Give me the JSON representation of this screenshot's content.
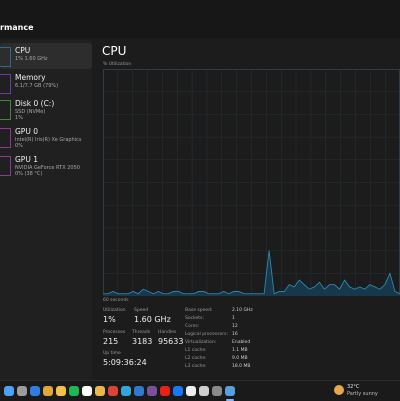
{
  "header": {
    "title": "rmance"
  },
  "sidebar": {
    "items": [
      {
        "name": "CPU",
        "sub": "1%  1.60 GHz",
        "sub2": "",
        "thumb_color": "#2a6a8f"
      },
      {
        "name": "Memory",
        "sub": "6.1/7.7 GB (79%)",
        "sub2": "",
        "thumb_color": "#6b3aa8"
      },
      {
        "name": "Disk 0 (C:)",
        "sub": "SSD (NVMe)",
        "sub2": "1%",
        "thumb_color": "#3c8a3c"
      },
      {
        "name": "GPU 0",
        "sub": "Intel(R) Iris(R) Xe Graphics",
        "sub2": "0%",
        "thumb_color": "#8a3c8a"
      },
      {
        "name": "GPU 1",
        "sub": "NVIDIA GeForce RTX 2050",
        "sub2": "0% (38 °C)",
        "thumb_color": "#8a3c8a"
      }
    ]
  },
  "main": {
    "title": "CPU",
    "axis_label": "% Utilization",
    "time_label": "60 seconds",
    "graph": {
      "line_color": "#2f8fbf",
      "fill_color": "#17384a",
      "grid_color": "#2a3a44",
      "values": [
        1,
        1,
        2,
        1,
        1,
        1,
        2,
        1,
        3,
        2,
        1,
        2,
        1,
        1,
        2,
        2,
        1,
        1,
        1,
        2,
        2,
        1,
        1,
        1,
        2,
        1,
        2,
        2,
        1,
        1,
        1,
        1,
        1,
        20,
        1,
        2,
        2,
        5,
        4,
        7,
        5,
        3,
        4,
        6,
        3,
        5,
        5,
        3,
        7,
        4,
        3,
        4,
        3,
        5,
        4,
        3,
        5,
        10,
        2,
        1
      ]
    },
    "stats": {
      "utilization": {
        "label": "Utilization",
        "value": "1%"
      },
      "speed": {
        "label": "Speed",
        "value": "1.60 GHz"
      },
      "processes": {
        "label": "Processes",
        "value": "215"
      },
      "threads": {
        "label": "Threads",
        "value": "3183"
      },
      "handles": {
        "label": "Handles",
        "value": "95633"
      },
      "uptime": {
        "label": "Up time",
        "value": "5:09:36:24"
      }
    },
    "details": [
      {
        "key": "Base speed:",
        "value": "2.10 GHz"
      },
      {
        "key": "Sockets:",
        "value": "1"
      },
      {
        "key": "Cores:",
        "value": "12"
      },
      {
        "key": "Logical processors:",
        "value": "16"
      },
      {
        "key": "Virtualization:",
        "value": "Enabled"
      },
      {
        "key": "L1 cache:",
        "value": "1.1 MB"
      },
      {
        "key": "L2 cache:",
        "value": "9.0 MB"
      },
      {
        "key": "L3 cache:",
        "value": "18.0 MB"
      }
    ]
  },
  "taskbar": {
    "icons": [
      {
        "name": "windows-start-icon",
        "color": "#4aa3f5"
      },
      {
        "name": "search-icon",
        "color": "#9c9c9c"
      },
      {
        "name": "widgets-icon",
        "color": "#2f7de0"
      },
      {
        "name": "photos-icon",
        "color": "#e0a63a"
      },
      {
        "name": "file-explorer-icon",
        "color": "#f0c248"
      },
      {
        "name": "spotify-icon",
        "color": "#1db954"
      },
      {
        "name": "store-icon",
        "color": "#ffffff"
      },
      {
        "name": "files-icon",
        "color": "#e8b84a"
      },
      {
        "name": "chrome-icon",
        "color": "#db4437"
      },
      {
        "name": "edge-icon",
        "color": "#36a6d8"
      },
      {
        "name": "vscode-icon",
        "color": "#2f7ad1"
      },
      {
        "name": "viber-icon",
        "color": "#7b519d"
      },
      {
        "name": "youtube-icon",
        "color": "#e62117"
      },
      {
        "name": "facebook-icon",
        "color": "#1877f2"
      },
      {
        "name": "tiktok-icon",
        "color": "#eeeeee"
      },
      {
        "name": "chatgpt-icon",
        "color": "#cfcfcf"
      },
      {
        "name": "media-icon",
        "color": "#8a8a8a"
      },
      {
        "name": "task-manager-icon",
        "color": "#56a0e0"
      }
    ],
    "weather": {
      "temp": "32°C",
      "desc": "Partly sunny"
    }
  }
}
